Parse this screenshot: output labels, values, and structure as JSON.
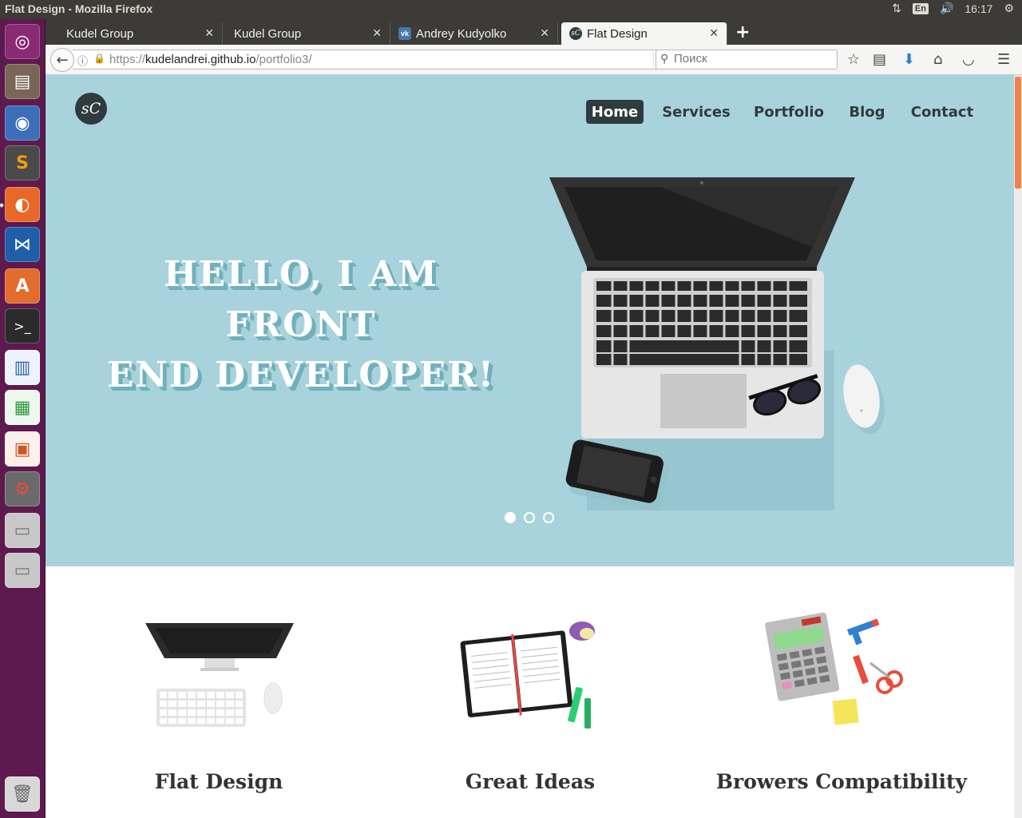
{
  "window": {
    "title": "Flat Design - Mozilla Firefox"
  },
  "panel": {
    "lang": "En",
    "time": "16:17"
  },
  "tabs": [
    {
      "label": "Kudel Group"
    },
    {
      "label": "Kudel Group"
    },
    {
      "label": "Andrey Kudyolko"
    },
    {
      "label": "Flat Design"
    }
  ],
  "urlbar": {
    "scheme": "https://",
    "host": "kudelandrei.github.io",
    "path": "/portfolio3/"
  },
  "search": {
    "placeholder": "Поиск"
  },
  "site": {
    "logo": "sC",
    "nav": [
      "Home",
      "Services",
      "Portfolio",
      "Blog",
      "Contact"
    ],
    "headline_line1": "HELLO, I AM FRONT",
    "headline_line2": "END DEVELOPER!",
    "slider": {
      "count": 3,
      "active": 1
    },
    "features": [
      "Flat Design",
      "Great Ideas",
      "Browers Compatibility"
    ]
  },
  "colors": {
    "hero_bg": "#a8d3dc",
    "nav_active_bg": "#2f3b3e",
    "launcher_bg": "#5e1a4f",
    "scroll_thumb": "#f08050"
  }
}
